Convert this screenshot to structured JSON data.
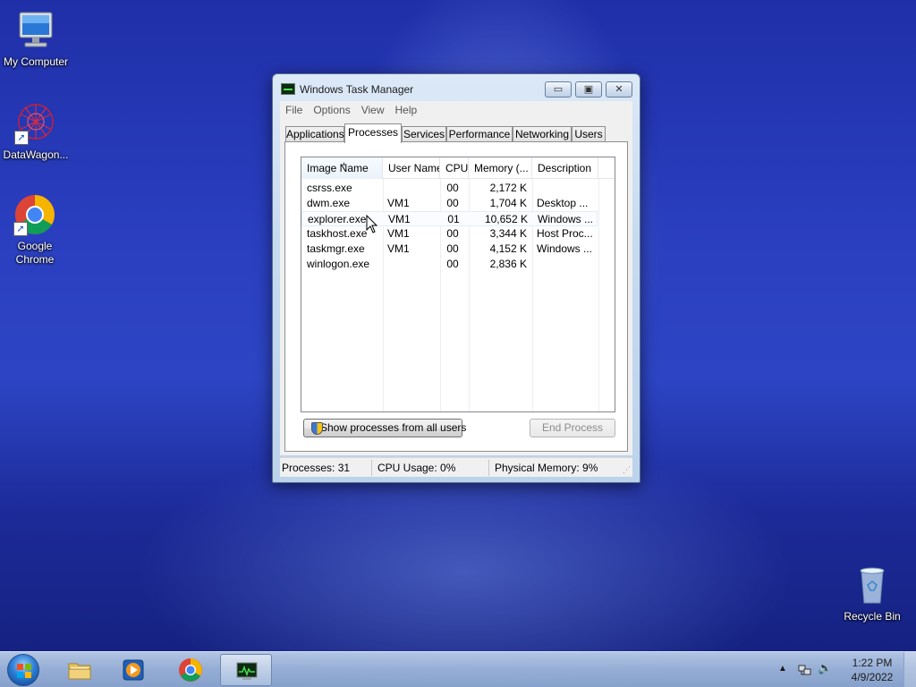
{
  "desktop": {
    "icons": [
      {
        "label": "My Computer"
      },
      {
        "label": "DataWagon..."
      },
      {
        "label": "Google Chrome"
      },
      {
        "label": "Recycle Bin"
      }
    ]
  },
  "window": {
    "title": "Windows Task Manager",
    "menu": [
      "File",
      "Options",
      "View",
      "Help"
    ],
    "tabs": [
      "Applications",
      "Processes",
      "Services",
      "Performance",
      "Networking",
      "Users"
    ],
    "active_tab": "Processes",
    "columns": [
      "Image Name",
      "User Name",
      "CPU",
      "Memory (...",
      "Description"
    ],
    "rows": [
      {
        "name": "csrss.exe",
        "user": "",
        "cpu": "00",
        "mem": "2,172 K",
        "desc": ""
      },
      {
        "name": "dwm.exe",
        "user": "VM1",
        "cpu": "00",
        "mem": "1,704 K",
        "desc": "Desktop ..."
      },
      {
        "name": "explorer.exe",
        "user": "VM1",
        "cpu": "01",
        "mem": "10,652 K",
        "desc": "Windows ..."
      },
      {
        "name": "taskhost.exe",
        "user": "VM1",
        "cpu": "00",
        "mem": "3,344 K",
        "desc": "Host Proc..."
      },
      {
        "name": "taskmgr.exe",
        "user": "VM1",
        "cpu": "00",
        "mem": "4,152 K",
        "desc": "Windows ..."
      },
      {
        "name": "winlogon.exe",
        "user": "",
        "cpu": "00",
        "mem": "2,836 K",
        "desc": ""
      }
    ],
    "show_all_label": "Show processes from all users",
    "end_process_label": "End Process",
    "status": {
      "processes": "Processes: 31",
      "cpu": "CPU Usage: 0%",
      "memory": "Physical Memory: 9%"
    }
  },
  "taskbar": {
    "time": "1:22 PM",
    "date": "4/9/2022"
  }
}
